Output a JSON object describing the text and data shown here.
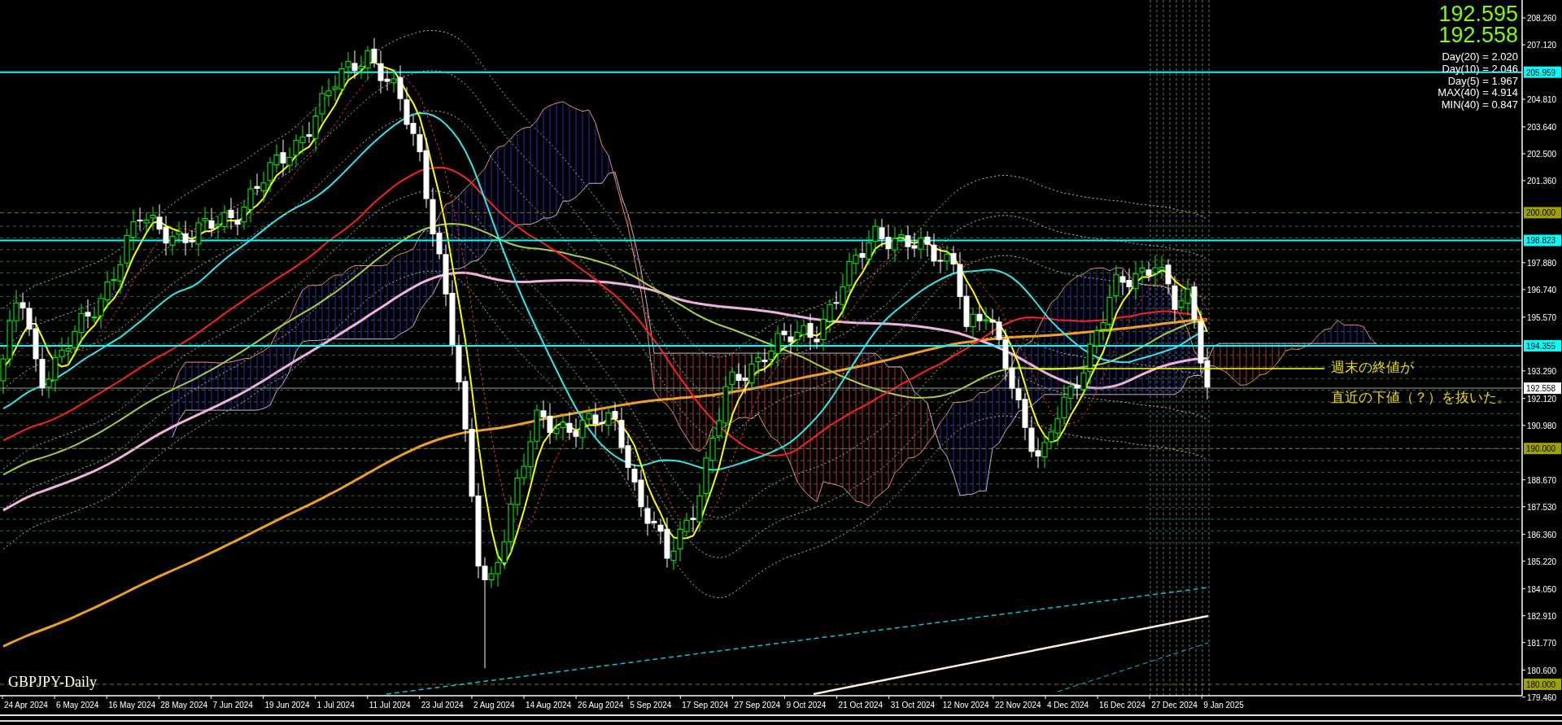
{
  "symbol_label": "GBPJPY-Daily",
  "quote": {
    "bid": "192.595",
    "ask": "192.558"
  },
  "indicator_readout": [
    "Day(20) = 2.020",
    "Day(10) = 2.046",
    "Day(5) = 1.967",
    "MAX(40) = 4.914",
    "MIN(40) = 0.847"
  ],
  "annotation": [
    "週末の終値が",
    "直近の下値（？）を抜いた。"
  ],
  "price_axis": {
    "ticks": [
      "208.260",
      "207.120",
      "204.810",
      "203.640",
      "202.500",
      "201.360",
      "197.880",
      "196.740",
      "195.570",
      "193.290",
      "192.120",
      "190.980",
      "188.670",
      "187.530",
      "186.360",
      "185.220",
      "184.050",
      "182.910",
      "181.770",
      "180.600",
      "179.460"
    ],
    "levels": [
      {
        "label": "205.959",
        "kind": "resistance"
      },
      {
        "label": "200.000",
        "kind": "round"
      },
      {
        "label": "198.823",
        "kind": "resistance"
      },
      {
        "label": "194.355",
        "kind": "resistance"
      },
      {
        "label": "192.558",
        "kind": "last"
      },
      {
        "label": "190.000",
        "kind": "round"
      },
      {
        "label": "180.000",
        "kind": "round"
      }
    ]
  },
  "time_axis": {
    "labels": [
      "24 Apr 2024",
      "6 May 2024",
      "16 May 2024",
      "28 May 2024",
      "7 Jun 2024",
      "19 Jun 2024",
      "1 Jul 2024",
      "11 Jul 2024",
      "23 Jul 2024",
      "2 Aug 2024",
      "14 Aug 2024",
      "26 Aug 2024",
      "5 Sep 2024",
      "17 Sep 2024",
      "27 Sep 2024",
      "9 Oct 2024",
      "21 Oct 2024",
      "31 Oct 2024",
      "12 Nov 2024",
      "22 Nov 2024",
      "4 Dec 2024",
      "16 Dec 2024",
      "27 Dec 2024",
      "9 Jan 2025"
    ]
  }
}
